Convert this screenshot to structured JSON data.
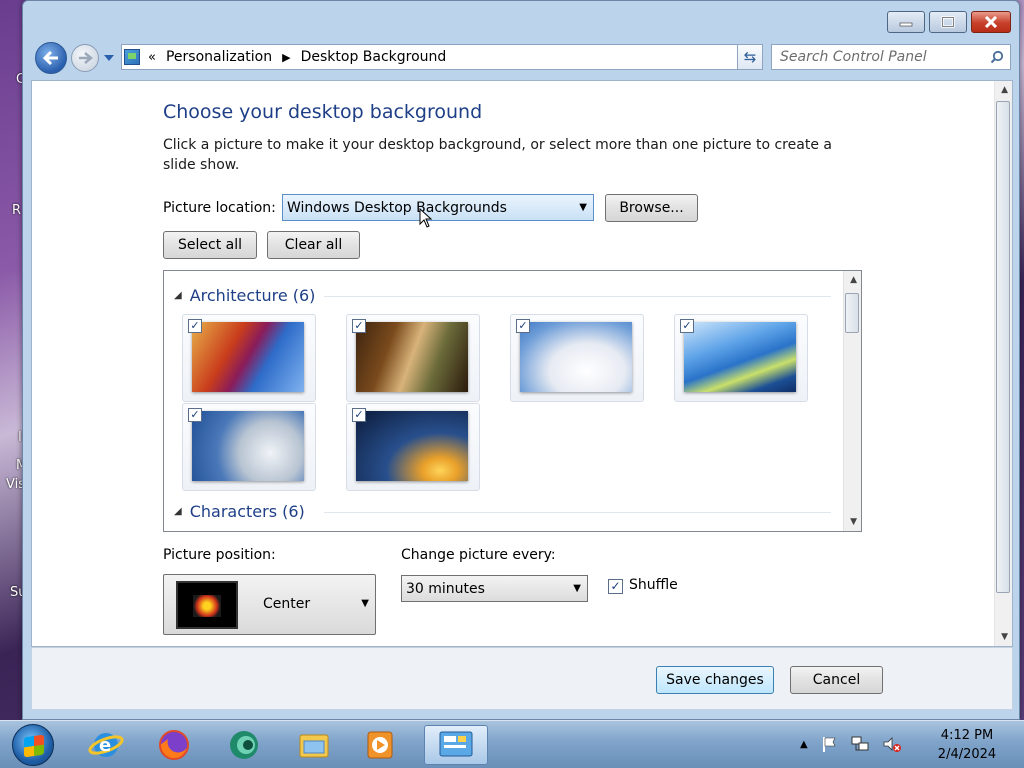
{
  "window": {
    "breadcrumb_lead": "«",
    "breadcrumbs": [
      "Personalization",
      "Desktop Background"
    ],
    "search_placeholder": "Search Control Panel"
  },
  "content": {
    "title": "Choose your desktop background",
    "description": "Click a picture to make it your desktop background, or select more than one picture to create a slide show.",
    "picture_location_label": "Picture location:",
    "picture_location_value": "Windows Desktop Backgrounds",
    "browse_label": "Browse...",
    "select_all_label": "Select all",
    "clear_all_label": "Clear all",
    "groups": [
      {
        "name": "Architecture",
        "count": "(6)",
        "icon": "expanded-triangle-icon",
        "items": [
          {
            "checked": true,
            "colors": [
              "#c93d1c",
              "#2e6cc9"
            ]
          },
          {
            "checked": true,
            "colors": [
              "#7a4a1c",
              "#d8b37a"
            ]
          },
          {
            "checked": true,
            "colors": [
              "#6f9ed8",
              "#f4f6fa"
            ]
          },
          {
            "checked": true,
            "colors": [
              "#2a73c9",
              "#c9e06a"
            ]
          },
          {
            "checked": true,
            "colors": [
              "#4a78b8",
              "#d6dde6"
            ]
          },
          {
            "checked": true,
            "colors": [
              "#0b1a3a",
              "#e9a02a"
            ]
          }
        ]
      },
      {
        "name": "Characters",
        "count": "(6)",
        "icon": "expanded-triangle-icon"
      }
    ],
    "picture_position_label": "Picture position:",
    "picture_position_value": "Center",
    "change_every_label": "Change picture every:",
    "change_every_value": "30 minutes",
    "shuffle_label": "Shuffle",
    "shuffle_checked": true
  },
  "footer": {
    "save_label": "Save changes",
    "cancel_label": "Cancel"
  },
  "taskbar": {
    "apps": [
      "internet-explorer",
      "firefox",
      "app-green-circle",
      "windows-explorer",
      "media-player",
      "control-panel"
    ],
    "time": "4:12 PM",
    "date": "2/4/2024"
  },
  "desktop": {
    "edge_letters": [
      "C",
      "R",
      "I",
      "M",
      "Vis",
      "Su"
    ]
  }
}
